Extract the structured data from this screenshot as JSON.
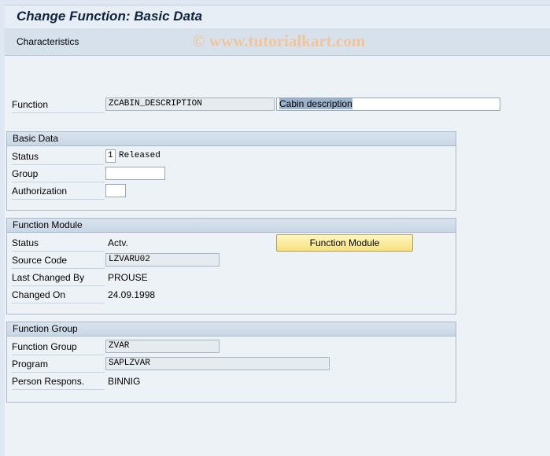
{
  "window": {
    "title": "Change Function: Basic Data"
  },
  "toolbar": {
    "characteristics_label": "Characteristics"
  },
  "watermark": "© www.tutorialkart.com",
  "function": {
    "label": "Function",
    "name": "ZCABIN_DESCRIPTION",
    "description": "Cabin description"
  },
  "basic_data": {
    "title": "Basic Data",
    "status_label": "Status",
    "status_code": "1",
    "status_text": "Released",
    "group_label": "Group",
    "group_value": "",
    "authorization_label": "Authorization",
    "authorization_value": ""
  },
  "function_module": {
    "title": "Function Module",
    "status_label": "Status",
    "status_value": "Actv.",
    "button_label": "Function Module",
    "source_code_label": "Source Code",
    "source_code_value": "LZVARU02",
    "last_changed_by_label": "Last Changed By",
    "last_changed_by_value": "PROUSE",
    "changed_on_label": "Changed On",
    "changed_on_value": "24.09.1998"
  },
  "function_group": {
    "title": "Function Group",
    "group_label": "Function Group",
    "group_value": "ZVAR",
    "program_label": "Program",
    "program_value": "SAPLZVAR",
    "person_label": "Person Respons.",
    "person_value": "BINNIG"
  }
}
